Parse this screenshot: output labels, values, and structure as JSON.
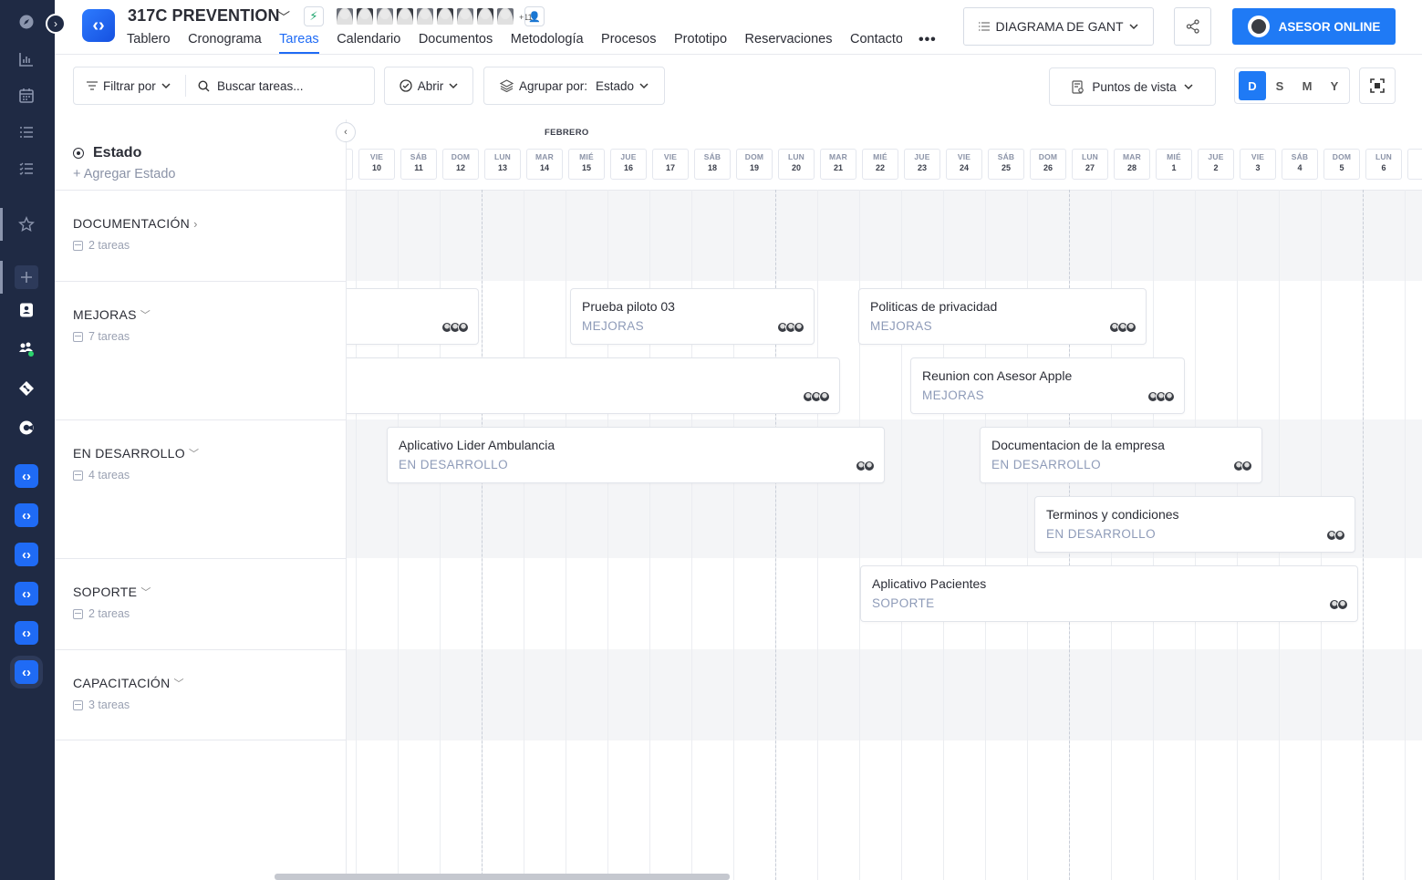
{
  "header": {
    "project_name": "317C PREVENTION",
    "avatars_more": "+11",
    "tabs": [
      "Tablero",
      "Cronograma",
      "Tareas",
      "Calendario",
      "Documentos",
      "Metodología",
      "Procesos",
      "Prototipo",
      "Reservaciones",
      "Contacto"
    ],
    "active_tab": "Tareas",
    "view_button": "DIAGRAMA DE GANT",
    "asesor_button": "ASESOR ONLINE"
  },
  "toolbar": {
    "filter_label": "Filtrar por",
    "search_placeholder": "Buscar tareas...",
    "open_label": "Abrir",
    "group_label": "Agrupar por:",
    "group_value": "Estado",
    "viewpoints_label": "Puntos de vista",
    "zoom_options": [
      "D",
      "S",
      "M",
      "Y"
    ],
    "zoom_selected": "D"
  },
  "groups_panel": {
    "title": "Estado",
    "add_label": "+ Agregar Estado",
    "groups": [
      {
        "name": "DOCUMENTACIÓN",
        "count": "2 tareas",
        "expanded": false
      },
      {
        "name": "MEJORAS",
        "count": "7 tareas",
        "expanded": true
      },
      {
        "name": "EN DESARROLLO",
        "count": "4 tareas",
        "expanded": true
      },
      {
        "name": "SOPORTE",
        "count": "2 tareas",
        "expanded": true
      },
      {
        "name": "CAPACITACIÓN",
        "count": "3 tareas",
        "expanded": true
      }
    ]
  },
  "timeline": {
    "month": "FEBRERO",
    "days": [
      {
        "name": "VIE",
        "num": "10"
      },
      {
        "name": "SÁB",
        "num": "11"
      },
      {
        "name": "DOM",
        "num": "12"
      },
      {
        "name": "LUN",
        "num": "13"
      },
      {
        "name": "MAR",
        "num": "14"
      },
      {
        "name": "MIÉ",
        "num": "15"
      },
      {
        "name": "JUE",
        "num": "16"
      },
      {
        "name": "VIE",
        "num": "17"
      },
      {
        "name": "SÁB",
        "num": "18"
      },
      {
        "name": "DOM",
        "num": "19"
      },
      {
        "name": "LUN",
        "num": "20"
      },
      {
        "name": "MAR",
        "num": "21"
      },
      {
        "name": "MIÉ",
        "num": "22"
      },
      {
        "name": "JUE",
        "num": "23"
      },
      {
        "name": "VIE",
        "num": "24"
      },
      {
        "name": "SÁB",
        "num": "25"
      },
      {
        "name": "DOM",
        "num": "26"
      },
      {
        "name": "LUN",
        "num": "27"
      },
      {
        "name": "MAR",
        "num": "28"
      },
      {
        "name": "MIÉ",
        "num": "1"
      },
      {
        "name": "JUE",
        "num": "2"
      },
      {
        "name": "VIE",
        "num": "3"
      },
      {
        "name": "SÁB",
        "num": "4"
      },
      {
        "name": "DOM",
        "num": "5"
      },
      {
        "name": "LUN",
        "num": "6"
      }
    ],
    "tasks": [
      {
        "name": "",
        "status": ""
      },
      {
        "name": "Prueba piloto 03",
        "status": "MEJORAS"
      },
      {
        "name": "Politicas de privacidad",
        "status": "MEJORAS"
      },
      {
        "name": "",
        "status": ""
      },
      {
        "name": "Reunion con Asesor Apple",
        "status": "MEJORAS"
      },
      {
        "name": "Aplicativo Lider Ambulancia",
        "status": "EN DESARROLLO"
      },
      {
        "name": "Documentacion de la empresa",
        "status": "EN DESARROLLO"
      },
      {
        "name": "Terminos y condiciones",
        "status": "EN DESARROLLO"
      },
      {
        "name": "Aplicativo Pacientes",
        "status": "SOPORTE"
      }
    ]
  }
}
